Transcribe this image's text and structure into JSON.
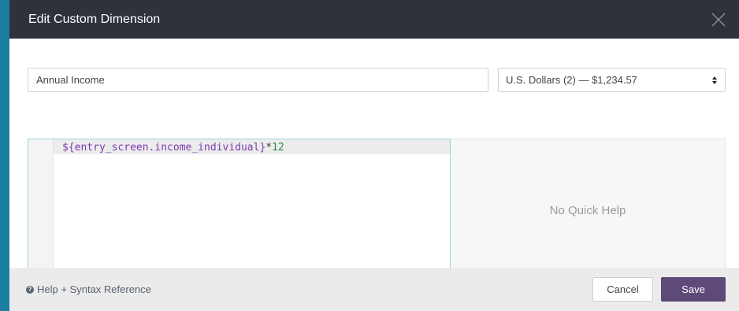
{
  "dialog": {
    "title": "Edit Custom Dimension",
    "close_icon": "close-icon"
  },
  "form": {
    "name_value": "Annual Income",
    "format_selected": "U.S. Dollars (2) — $1,234.57"
  },
  "editor": {
    "code_variable": "${entry_screen.income_individual}",
    "code_operator": "*",
    "code_number": "12"
  },
  "quick_help": {
    "text": "No Quick Help"
  },
  "footer": {
    "help_link": "Help + Syntax Reference",
    "cancel_label": "Cancel",
    "save_label": "Save"
  },
  "colors": {
    "header_bg": "#2f313b",
    "save_bg": "#5d4a7a",
    "editor_border": "#9fd1e0",
    "backdrop": "#1a7fa0"
  }
}
